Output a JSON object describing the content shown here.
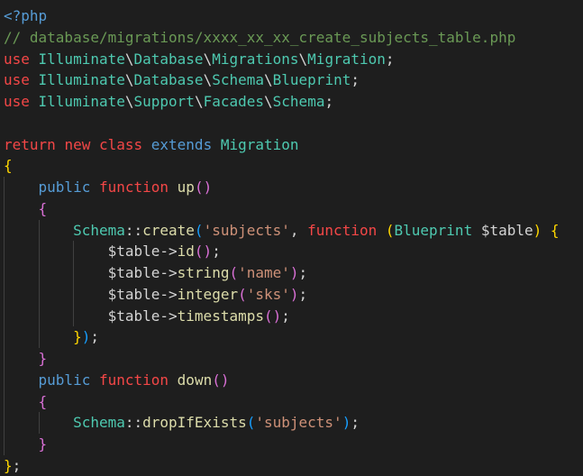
{
  "editor": {
    "language": "php",
    "colors": {
      "background": "#1e1e1e",
      "plain": "#d4d4d4",
      "keyword_control": "#c586c0",
      "keyword_storage": "#569cd6",
      "keyword_red": "#f44747",
      "comment": "#6a9955",
      "string": "#ce9178",
      "class_name": "#4ec9b0",
      "function_name": "#dcdcaa",
      "variable": "#9cdcfe",
      "bracket_gold": "#ffd700",
      "bracket_pink": "#da70d6",
      "bracket_blue": "#179fff",
      "indent_guide": "#404040"
    },
    "lines": [
      {
        "indent": 0,
        "tokens": [
          {
            "t": "<?php",
            "c": "keyword_storage"
          }
        ]
      },
      {
        "indent": 0,
        "tokens": [
          {
            "t": "// database/migrations/xxxx_xx_xx_create_subjects_table.php",
            "c": "comment"
          }
        ]
      },
      {
        "indent": 0,
        "tokens": [
          {
            "t": "use ",
            "c": "keyword_red"
          },
          {
            "t": "Illuminate",
            "c": "class_name"
          },
          {
            "t": "\\",
            "c": "plain"
          },
          {
            "t": "Database",
            "c": "class_name"
          },
          {
            "t": "\\",
            "c": "plain"
          },
          {
            "t": "Migrations",
            "c": "class_name"
          },
          {
            "t": "\\",
            "c": "plain"
          },
          {
            "t": "Migration",
            "c": "class_name"
          },
          {
            "t": ";",
            "c": "plain"
          }
        ]
      },
      {
        "indent": 0,
        "tokens": [
          {
            "t": "use ",
            "c": "keyword_red"
          },
          {
            "t": "Illuminate",
            "c": "class_name"
          },
          {
            "t": "\\",
            "c": "plain"
          },
          {
            "t": "Database",
            "c": "class_name"
          },
          {
            "t": "\\",
            "c": "plain"
          },
          {
            "t": "Schema",
            "c": "class_name"
          },
          {
            "t": "\\",
            "c": "plain"
          },
          {
            "t": "Blueprint",
            "c": "class_name"
          },
          {
            "t": ";",
            "c": "plain"
          }
        ]
      },
      {
        "indent": 0,
        "tokens": [
          {
            "t": "use ",
            "c": "keyword_red"
          },
          {
            "t": "Illuminate",
            "c": "class_name"
          },
          {
            "t": "\\",
            "c": "plain"
          },
          {
            "t": "Support",
            "c": "class_name"
          },
          {
            "t": "\\",
            "c": "plain"
          },
          {
            "t": "Facades",
            "c": "class_name"
          },
          {
            "t": "\\",
            "c": "plain"
          },
          {
            "t": "Schema",
            "c": "class_name"
          },
          {
            "t": ";",
            "c": "plain"
          }
        ]
      },
      {
        "indent": 0,
        "tokens": []
      },
      {
        "indent": 0,
        "tokens": [
          {
            "t": "return ",
            "c": "keyword_red"
          },
          {
            "t": "new ",
            "c": "keyword_red"
          },
          {
            "t": "class ",
            "c": "keyword_red"
          },
          {
            "t": "extends ",
            "c": "keyword_storage"
          },
          {
            "t": "Migration",
            "c": "class_name"
          }
        ]
      },
      {
        "indent": 0,
        "tokens": [
          {
            "t": "{",
            "c": "bracket_gold"
          }
        ]
      },
      {
        "indent": 1,
        "tokens": [
          {
            "t": "    ",
            "c": "plain"
          },
          {
            "t": "public ",
            "c": "keyword_storage"
          },
          {
            "t": "function ",
            "c": "keyword_red"
          },
          {
            "t": "up",
            "c": "function_name"
          },
          {
            "t": "()",
            "c": "bracket_pink"
          }
        ]
      },
      {
        "indent": 1,
        "tokens": [
          {
            "t": "    ",
            "c": "plain"
          },
          {
            "t": "{",
            "c": "bracket_pink"
          }
        ]
      },
      {
        "indent": 2,
        "tokens": [
          {
            "t": "        ",
            "c": "plain"
          },
          {
            "t": "Schema",
            "c": "class_name"
          },
          {
            "t": "::",
            "c": "plain"
          },
          {
            "t": "create",
            "c": "function_name"
          },
          {
            "t": "(",
            "c": "bracket_blue"
          },
          {
            "t": "'subjects'",
            "c": "string"
          },
          {
            "t": ", ",
            "c": "plain"
          },
          {
            "t": "function ",
            "c": "keyword_red"
          },
          {
            "t": "(",
            "c": "bracket_gold"
          },
          {
            "t": "Blueprint",
            "c": "class_name"
          },
          {
            "t": " ",
            "c": "plain"
          },
          {
            "t": "$table",
            "c": "plain"
          },
          {
            "t": ")",
            "c": "bracket_gold"
          },
          {
            "t": " ",
            "c": "plain"
          },
          {
            "t": "{",
            "c": "bracket_gold"
          }
        ]
      },
      {
        "indent": 3,
        "tokens": [
          {
            "t": "            ",
            "c": "plain"
          },
          {
            "t": "$table",
            "c": "plain"
          },
          {
            "t": "->",
            "c": "plain"
          },
          {
            "t": "id",
            "c": "function_name"
          },
          {
            "t": "()",
            "c": "bracket_pink"
          },
          {
            "t": ";",
            "c": "plain"
          }
        ]
      },
      {
        "indent": 3,
        "tokens": [
          {
            "t": "            ",
            "c": "plain"
          },
          {
            "t": "$table",
            "c": "plain"
          },
          {
            "t": "->",
            "c": "plain"
          },
          {
            "t": "string",
            "c": "function_name"
          },
          {
            "t": "(",
            "c": "bracket_pink"
          },
          {
            "t": "'name'",
            "c": "string"
          },
          {
            "t": ")",
            "c": "bracket_pink"
          },
          {
            "t": ";",
            "c": "plain"
          }
        ]
      },
      {
        "indent": 3,
        "tokens": [
          {
            "t": "            ",
            "c": "plain"
          },
          {
            "t": "$table",
            "c": "plain"
          },
          {
            "t": "->",
            "c": "plain"
          },
          {
            "t": "integer",
            "c": "function_name"
          },
          {
            "t": "(",
            "c": "bracket_pink"
          },
          {
            "t": "'sks'",
            "c": "string"
          },
          {
            "t": ")",
            "c": "bracket_pink"
          },
          {
            "t": ";",
            "c": "plain"
          }
        ]
      },
      {
        "indent": 3,
        "tokens": [
          {
            "t": "            ",
            "c": "plain"
          },
          {
            "t": "$table",
            "c": "plain"
          },
          {
            "t": "->",
            "c": "plain"
          },
          {
            "t": "timestamps",
            "c": "function_name"
          },
          {
            "t": "()",
            "c": "bracket_pink"
          },
          {
            "t": ";",
            "c": "plain"
          }
        ]
      },
      {
        "indent": 2,
        "tokens": [
          {
            "t": "        ",
            "c": "plain"
          },
          {
            "t": "}",
            "c": "bracket_gold"
          },
          {
            "t": ")",
            "c": "bracket_blue"
          },
          {
            "t": ";",
            "c": "plain"
          }
        ]
      },
      {
        "indent": 1,
        "tokens": [
          {
            "t": "    ",
            "c": "plain"
          },
          {
            "t": "}",
            "c": "bracket_pink"
          }
        ]
      },
      {
        "indent": 1,
        "tokens": [
          {
            "t": "    ",
            "c": "plain"
          },
          {
            "t": "public ",
            "c": "keyword_storage"
          },
          {
            "t": "function ",
            "c": "keyword_red"
          },
          {
            "t": "down",
            "c": "function_name"
          },
          {
            "t": "()",
            "c": "bracket_pink"
          }
        ]
      },
      {
        "indent": 1,
        "tokens": [
          {
            "t": "    ",
            "c": "plain"
          },
          {
            "t": "{",
            "c": "bracket_pink"
          }
        ]
      },
      {
        "indent": 2,
        "tokens": [
          {
            "t": "        ",
            "c": "plain"
          },
          {
            "t": "Schema",
            "c": "class_name"
          },
          {
            "t": "::",
            "c": "plain"
          },
          {
            "t": "dropIfExists",
            "c": "function_name"
          },
          {
            "t": "(",
            "c": "bracket_blue"
          },
          {
            "t": "'subjects'",
            "c": "string"
          },
          {
            "t": ")",
            "c": "bracket_blue"
          },
          {
            "t": ";",
            "c": "plain"
          }
        ]
      },
      {
        "indent": 1,
        "tokens": [
          {
            "t": "    ",
            "c": "plain"
          },
          {
            "t": "}",
            "c": "bracket_pink"
          }
        ]
      },
      {
        "indent": 0,
        "tokens": [
          {
            "t": "}",
            "c": "bracket_gold"
          },
          {
            "t": ";",
            "c": "plain"
          }
        ]
      }
    ]
  }
}
